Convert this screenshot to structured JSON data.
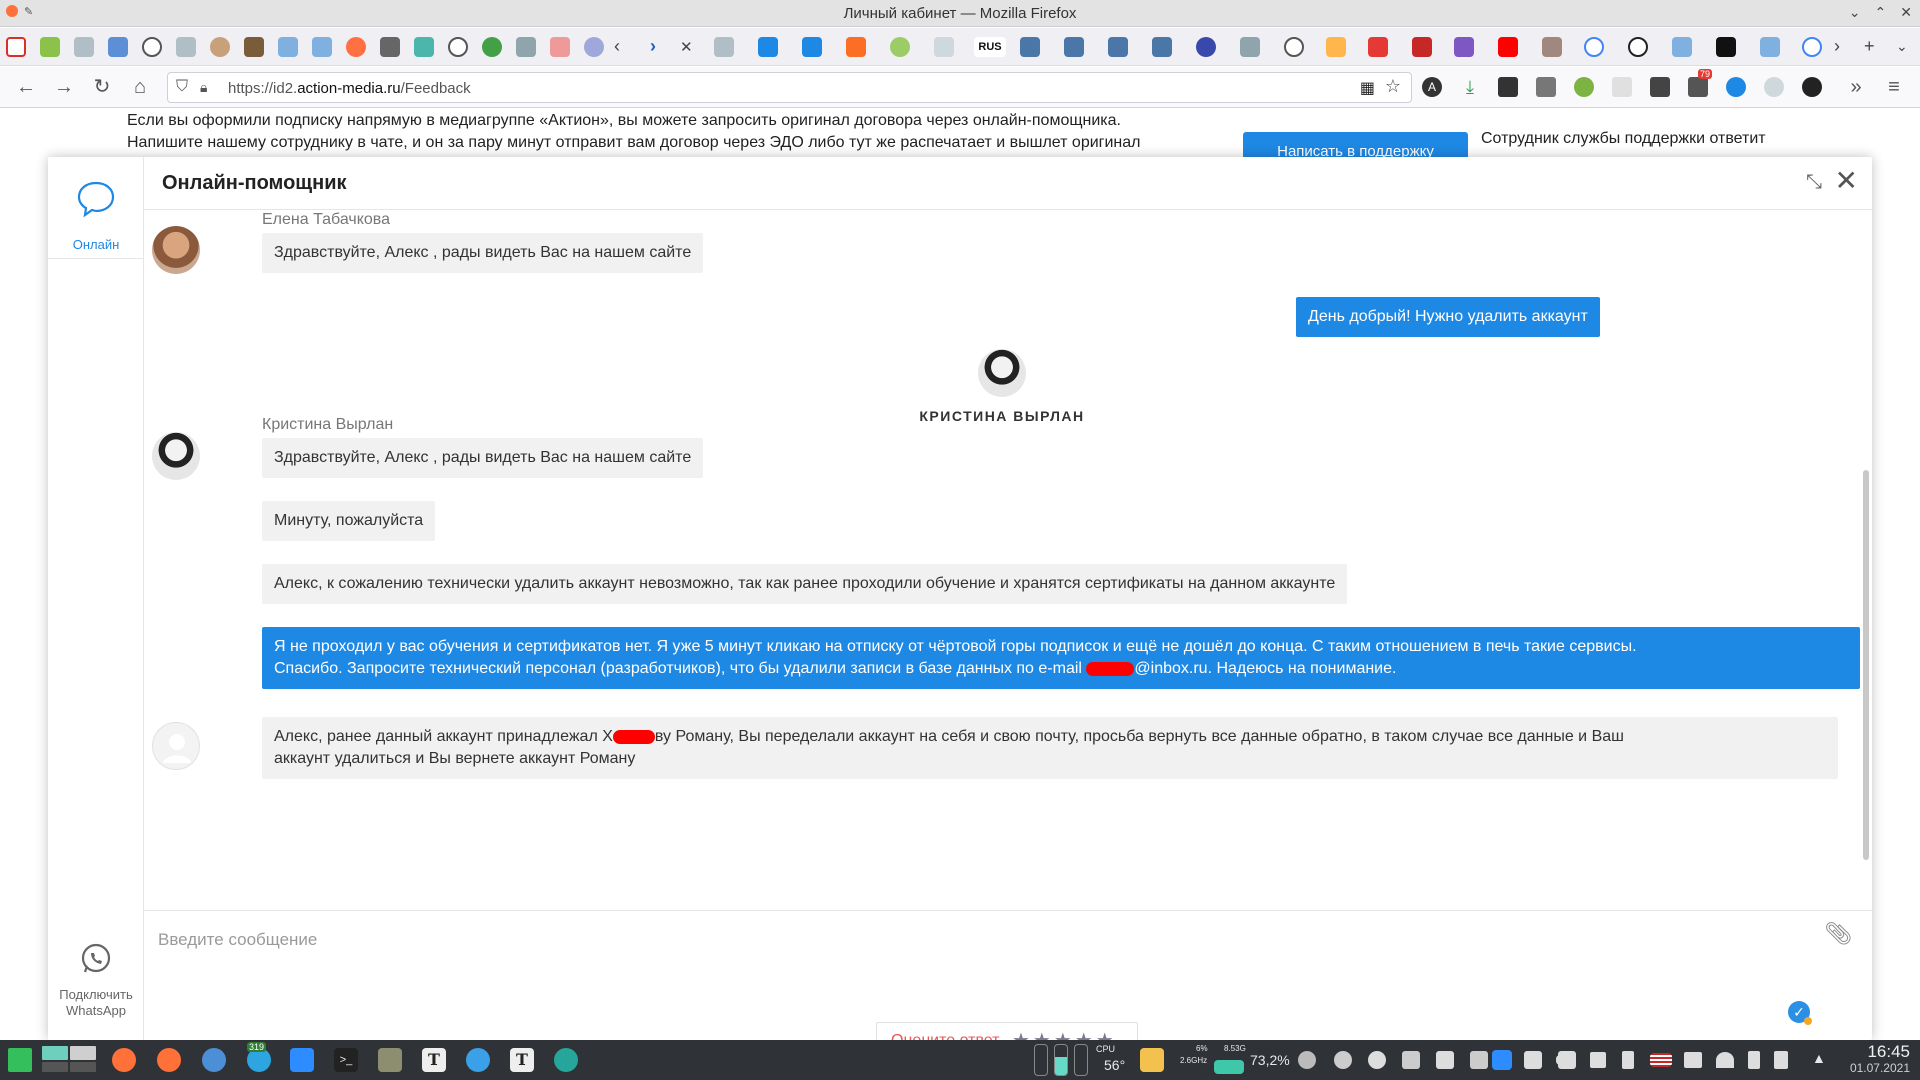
{
  "window": {
    "title": "Личный кабинет — Mozilla Firefox"
  },
  "browser": {
    "url_prefix": "https://id2.",
    "url_domain": "action-media.ru",
    "url_path": "/Feedback",
    "badge_count": "79"
  },
  "page": {
    "text_line1": "Если вы оформили подписку напрямую в медиагруппе «Актион», вы можете запросить оригинал договора через онлайн-помощника.",
    "text_line2": "Напишите нашему сотруднику в чате, и он за пару минут отправит вам договор через ЭДО либо тут же распечатает и вышлет оригинал",
    "support_button": "Написать в поддержку",
    "support_text": "Сотрудник службы поддержки ответит"
  },
  "chat": {
    "title": "Онлайн-помощник",
    "sidebar": {
      "online_label": "Онлайн",
      "whatsapp_label_1": "Подключить",
      "whatsapp_label_2": "WhatsApp"
    },
    "messages": {
      "m1_sender": "Елена Табачкова",
      "m1_text": "Здравствуйте, Алекс , рады видеть Вас на нашем сайте",
      "m2_text": "День добрый! Нужно удалить аккаунт",
      "agent_join_name": "КРИСТИНА ВЫРЛАН",
      "m3_sender": "Кристина Вырлан",
      "m3_text": "Здравствуйте, Алекс , рады видеть Вас на нашем сайте",
      "m4_text": "Минуту, пожалуйста",
      "m5_text": "Алекс, к сожалению технически удалить аккаунт невозможно, так как ранее проходили обучение и хранятся сертификаты на данном аккаунте",
      "m6_line1": "Я не проходил у вас обучения и сертификатов нет. Я уже 5 минут кликаю на отписку от чёртовой горы подписок и ещё не дошёл до конца. С таким отношением в печь такие сервисы.",
      "m6_line2_a": "Спасибо. Запросите технический персонал (разработчиков), что бы удалили записи в базе данных по e-mail ",
      "m6_line2_b": "@inbox.ru. Надеюсь на понимание.",
      "m7_line1_a": "Алекс, ранее данный аккаунт принадлежал Х",
      "m7_line1_b": "ву Роману, Вы переделали аккаунт на себя и свою почту, просьба вернуть все данные обратно, в таком случае все данные и Ваш",
      "m7_line2": "аккаунт удалиться и Вы вернете аккаунт Роману"
    },
    "rating_label": "Оцените ответ",
    "stars": "★★★★★",
    "input_placeholder": "Введите сообщение"
  },
  "taskbar": {
    "badge": "319",
    "cpu_label": "CPU",
    "cpu_temp": "56°",
    "freq": "2.6GHz",
    "cpu_pct": "6%",
    "mem": "8.53G",
    "mem_pct": "73,2%",
    "time": "16:45",
    "date": "01.07.2021"
  },
  "colors": {
    "accent": "#1e88e5",
    "redaction": "#ff0000"
  }
}
